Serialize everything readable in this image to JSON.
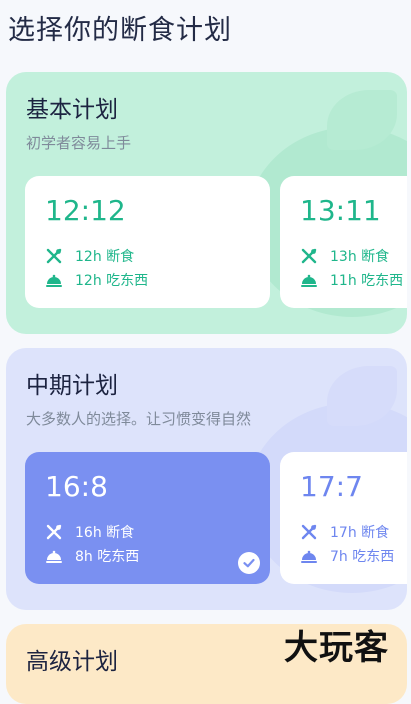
{
  "header": {
    "title": "选择你的断食计划"
  },
  "sections": [
    {
      "title": "基本计划",
      "subtitle": "初学者容易上手",
      "cards": [
        {
          "time": "12:12",
          "fast": "12h 断食",
          "eat": "12h 吃东西",
          "selected": false
        },
        {
          "time": "13:11",
          "fast": "13h 断食",
          "eat": "11h 吃东西",
          "selected": false
        }
      ]
    },
    {
      "title": "中期计划",
      "subtitle": "大多数人的选择。让习惯变得自然",
      "cards": [
        {
          "time": "16:8",
          "fast": "16h 断食",
          "eat": "8h 吃东西",
          "selected": true
        },
        {
          "time": "17:7",
          "fast": "17h 断食",
          "eat": "7h 吃东西",
          "selected": false
        }
      ]
    },
    {
      "title": "高级计划"
    }
  ],
  "icons": {
    "fast": "fork-knife-crossed-icon",
    "eat": "food-cloche-icon",
    "check": "check-circle-icon"
  },
  "colors": {
    "basic_accent": "#1fb68b",
    "mid_accent": "#6e86ef",
    "selected_card": "#7a90f1"
  },
  "watermark": "大玩客"
}
